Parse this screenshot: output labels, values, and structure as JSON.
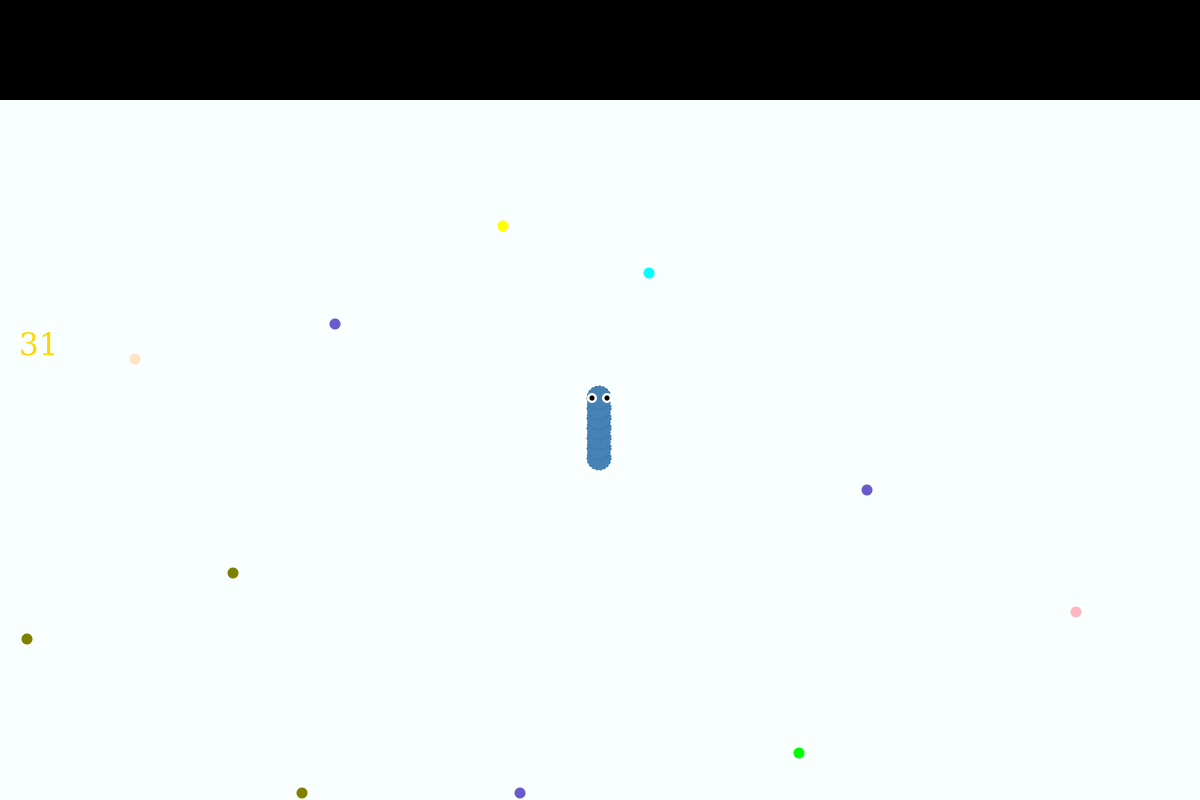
{
  "score": "31",
  "colors": {
    "background": "#f8fffe",
    "top_bar": "#000000",
    "score_text": "#ffd700",
    "snake_body": "#4682b4",
    "snake_eye_white": "#ffffff",
    "snake_pupil": "#000000"
  },
  "snake": {
    "direction": "up",
    "segments": 7
  },
  "food": [
    {
      "color": "#ffff00"
    },
    {
      "color": "#00ffff"
    },
    {
      "color": "#6a5acd"
    },
    {
      "color": "#ffe4c4"
    },
    {
      "color": "#6a5acd"
    },
    {
      "color": "#808000"
    },
    {
      "color": "#808000"
    },
    {
      "color": "#ffb6c1"
    },
    {
      "color": "#00ff00"
    },
    {
      "color": "#808000"
    },
    {
      "color": "#6a5acd"
    }
  ]
}
